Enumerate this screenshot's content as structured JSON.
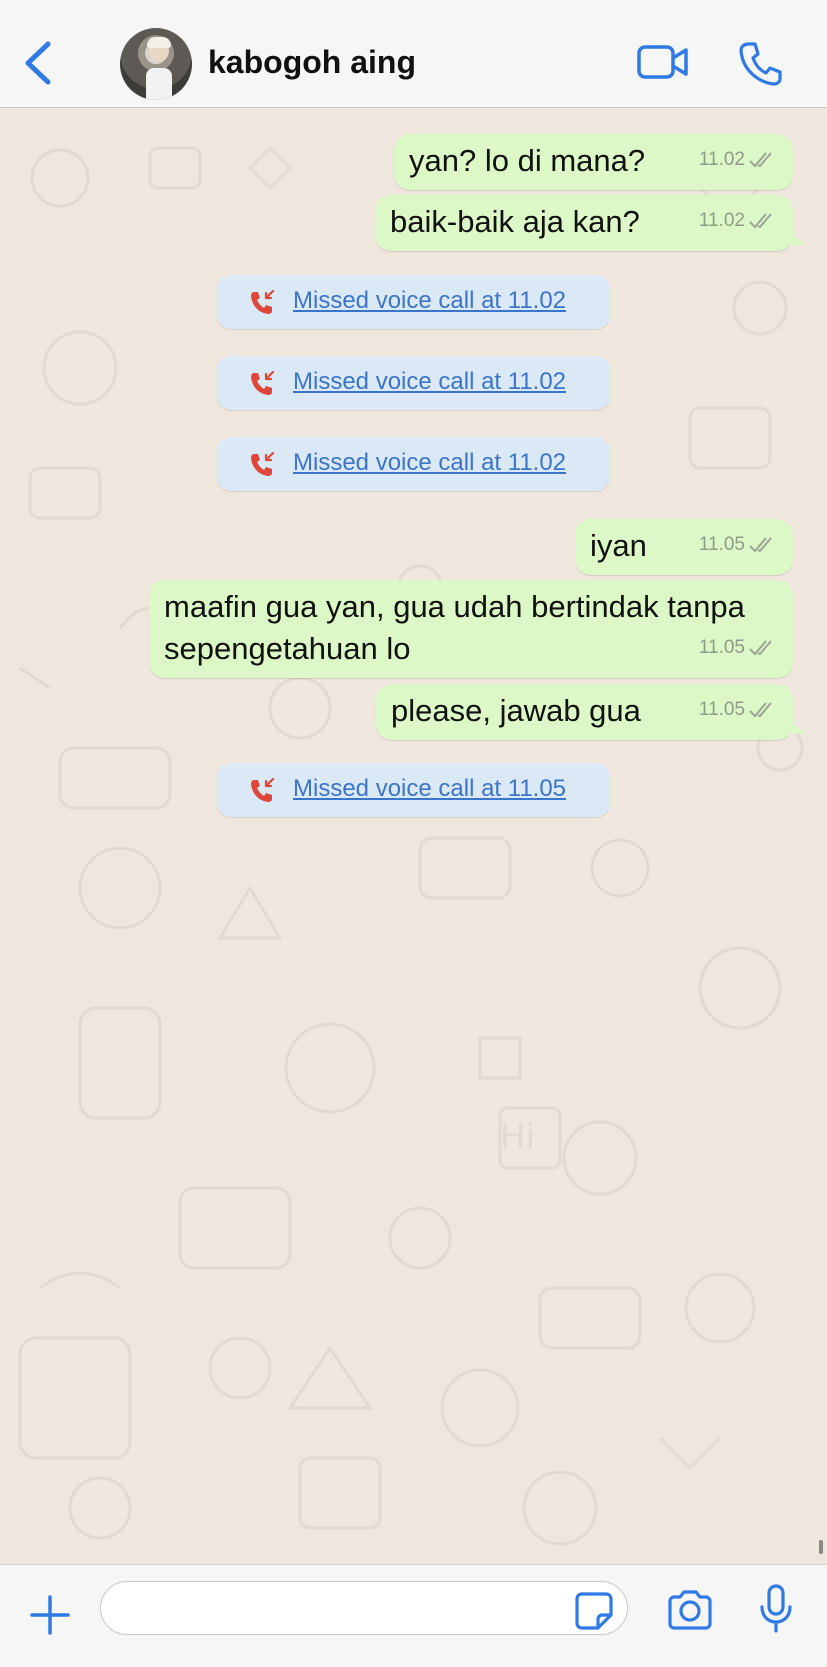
{
  "header": {
    "contact_name": "kabogoh aing"
  },
  "messages": [
    {
      "type": "outgoing",
      "text": "yan? lo di mana?",
      "time": "11.02"
    },
    {
      "type": "outgoing",
      "text": "baik-baik aja kan?",
      "time": "11.02"
    },
    {
      "type": "missed_call",
      "text": "Missed voice call at 11.02"
    },
    {
      "type": "missed_call",
      "text": "Missed voice call at 11.02"
    },
    {
      "type": "missed_call",
      "text": "Missed voice call at 11.02"
    },
    {
      "type": "outgoing",
      "text": "iyan",
      "time": "11.05"
    },
    {
      "type": "outgoing",
      "text": "maafin gua yan, gua udah bertindak tanpa\nsepengetahuan lo",
      "time": "11.05"
    },
    {
      "type": "outgoing",
      "text": "please, jawab gua",
      "time": "11.05"
    },
    {
      "type": "missed_call",
      "text": "Missed voice call at 11.05"
    }
  ],
  "composer": {
    "value": "",
    "placeholder": ""
  },
  "colors": {
    "accent": "#2f7ae5",
    "outgoing_bubble": "#dcf8c6",
    "missed_call_bubble": "#dbe9f7",
    "missed_call_icon": "#e0463a",
    "missed_call_link": "#3b75c9",
    "chat_background": "#efe7de"
  },
  "icons": {
    "back": "chevron-left-icon",
    "video": "video-camera-icon",
    "call": "phone-icon",
    "missed_call": "missed-call-icon",
    "read_receipt": "double-check-icon",
    "plus": "plus-icon",
    "sticker": "sticker-icon",
    "camera": "camera-icon",
    "mic": "microphone-icon"
  }
}
